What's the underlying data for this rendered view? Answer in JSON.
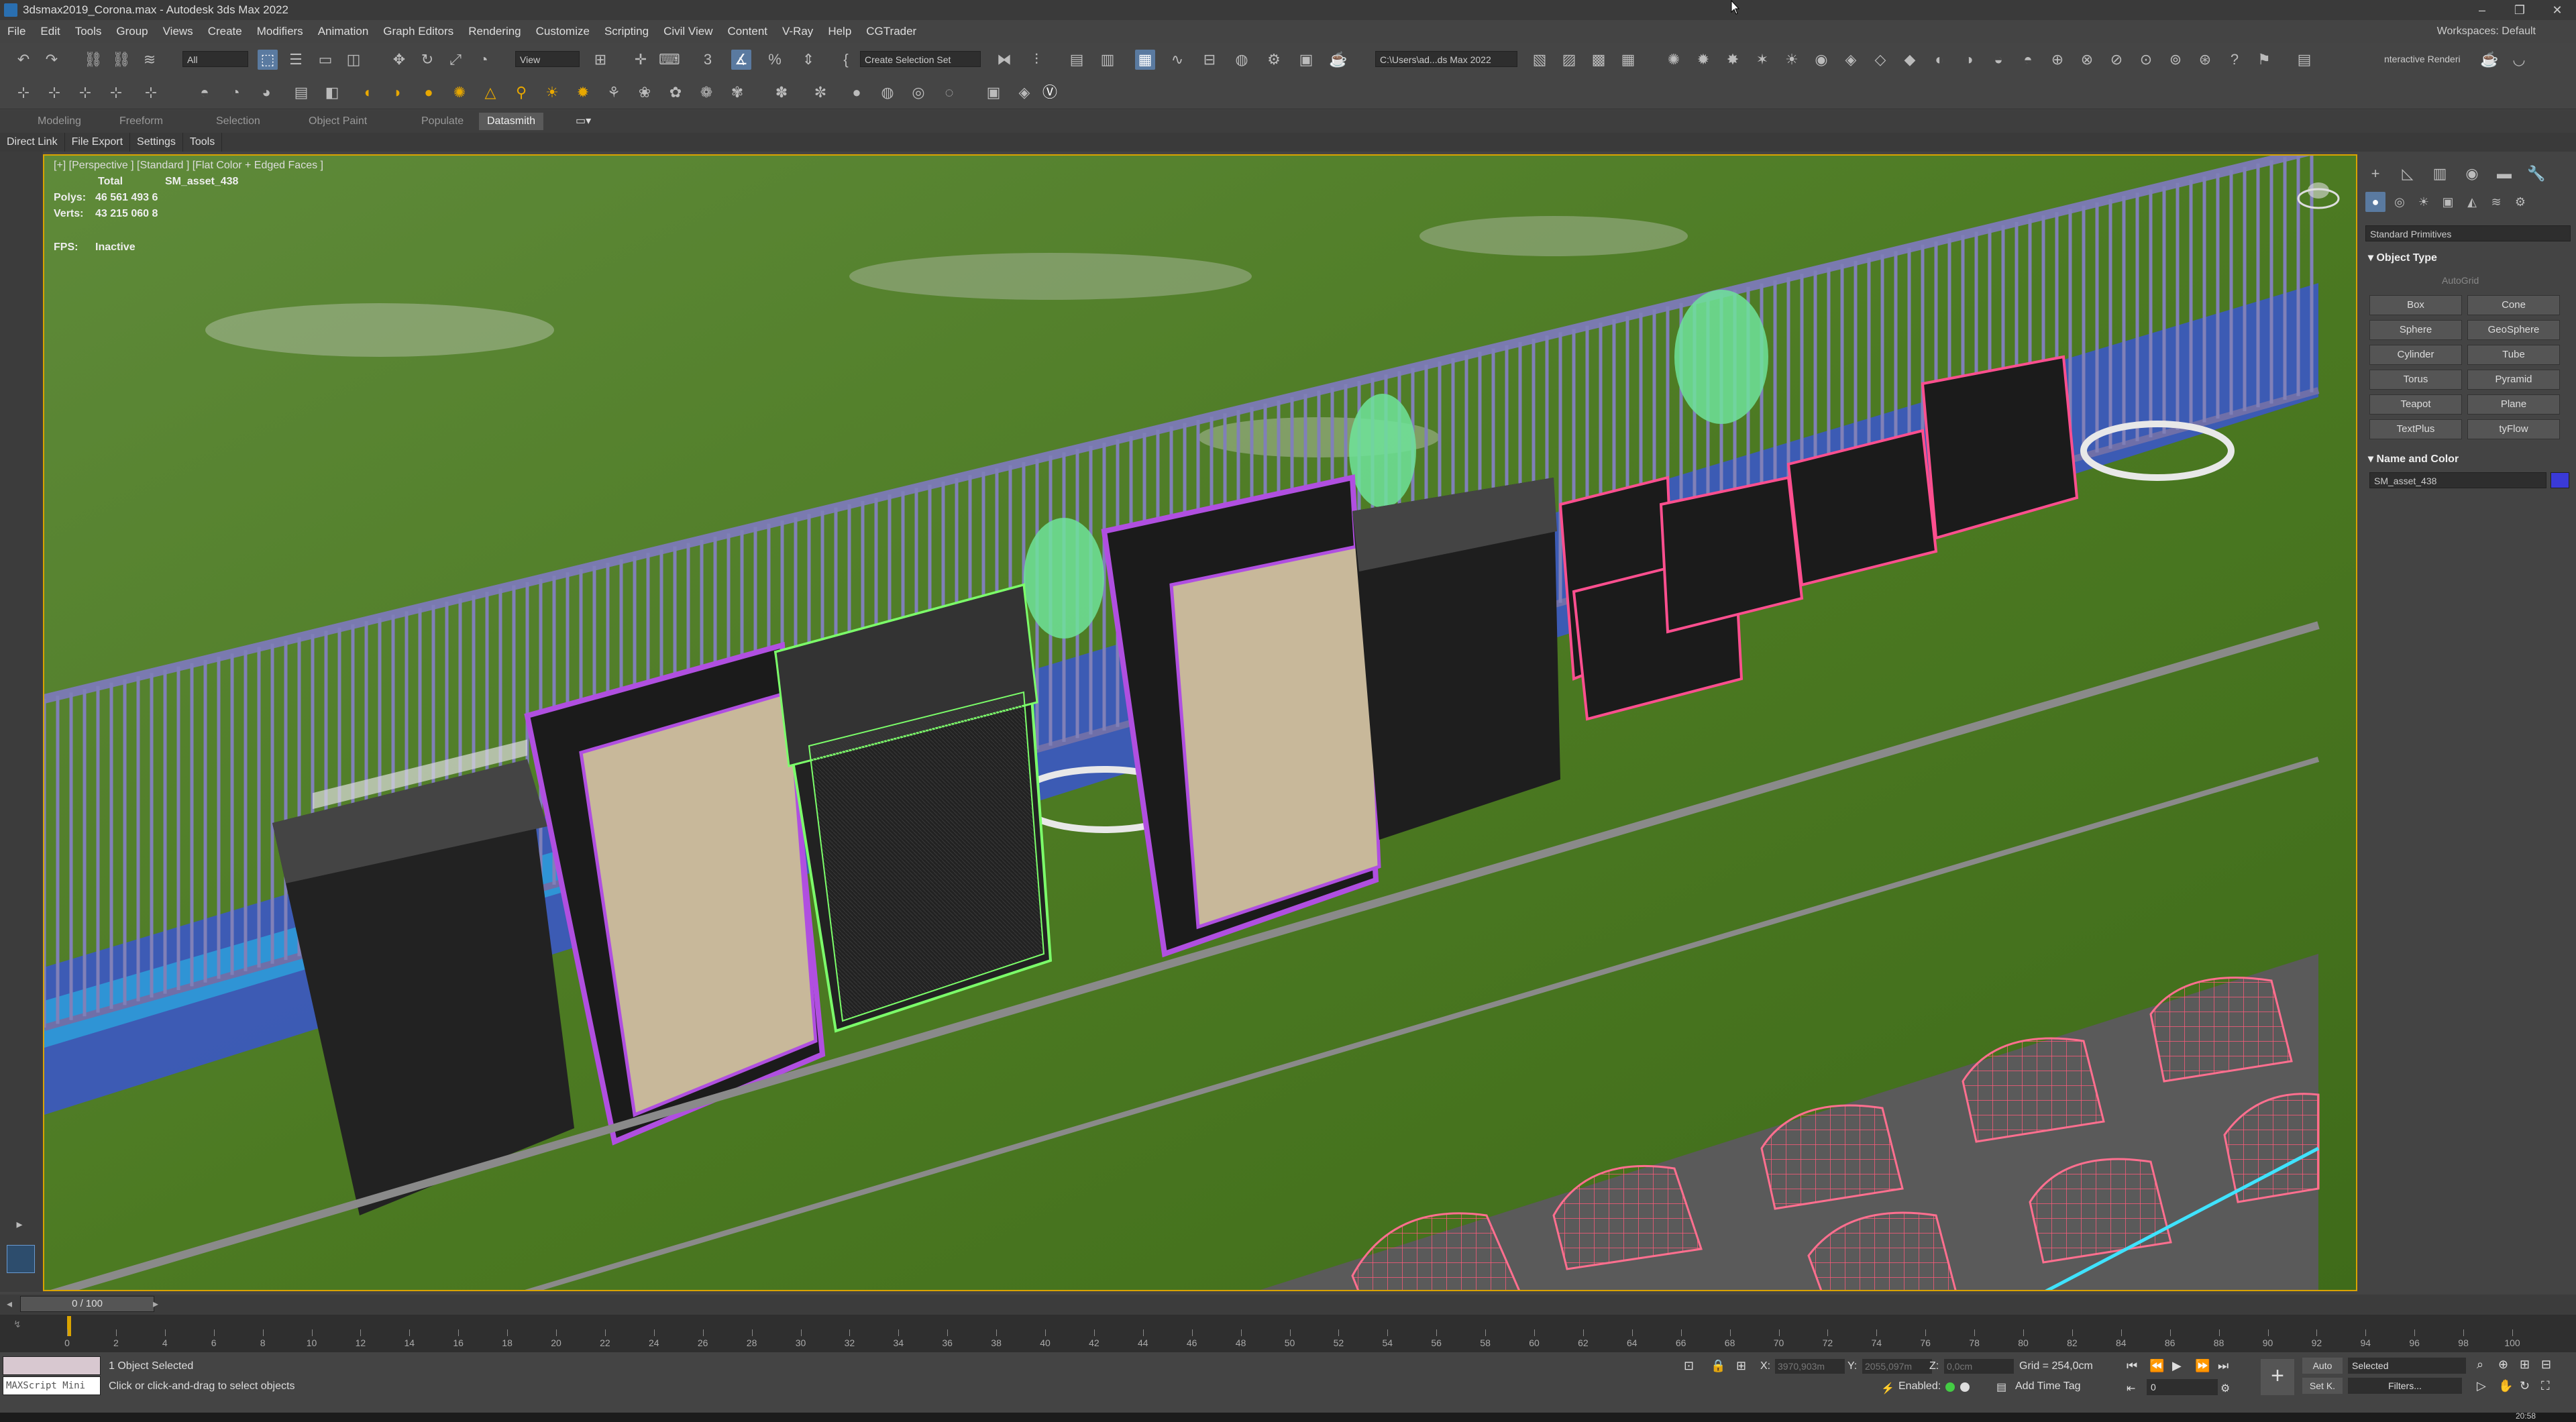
{
  "window": {
    "title": "3dsmax2019_Corona.max - Autodesk 3ds Max 2022",
    "minimize": "–",
    "maximize": "❐",
    "close": "✕"
  },
  "menu": {
    "items": [
      "File",
      "Edit",
      "Tools",
      "Group",
      "Views",
      "Create",
      "Modifiers",
      "Animation",
      "Graph Editors",
      "Rendering",
      "Customize",
      "Scripting",
      "Civil View",
      "Content",
      "V-Ray",
      "Help",
      "CGTrader"
    ],
    "workspaces_label": "Workspaces:",
    "workspaces_value": "Default"
  },
  "toolbar": {
    "selection_filter": "All",
    "view_dropdown": "View",
    "create_selection_set": "Create Selection Set",
    "project_path": "C:\\Users\\ad...ds Max 2022",
    "interactive_render": "nteractive Renderi"
  },
  "ribbon": {
    "tabs": [
      "Modeling",
      "Freeform",
      "Selection",
      "Object Paint",
      "Populate",
      "Datasmith"
    ],
    "active_tab": "Datasmith",
    "subtabs": [
      "Direct Link",
      "File Export",
      "Settings",
      "Tools"
    ]
  },
  "viewport": {
    "label": "[+] [Perspective ] [Standard ] [Flat Color + Edged Faces ]",
    "stats_total_label": "Total",
    "stats_object": "SM_asset_438",
    "polys_label": "Polys:",
    "polys_value": "46 561 493   6",
    "verts_label": "Verts:",
    "verts_value": "43 215 060   8",
    "fps_label": "FPS:",
    "fps_value": "Inactive"
  },
  "command_panel": {
    "category": "Standard Primitives",
    "object_type_header": "Object Type",
    "autogrid": "AutoGrid",
    "buttons": [
      "Box",
      "Cone",
      "Sphere",
      "GeoSphere",
      "Cylinder",
      "Tube",
      "Torus",
      "Pyramid",
      "Teapot",
      "Plane",
      "TextPlus",
      "tyFlow"
    ],
    "name_color_header": "Name and Color",
    "object_name": "SM_asset_438",
    "object_color": "#3a3ad8"
  },
  "timeline": {
    "frame_display": "0 / 100",
    "ticks": [
      "0",
      "2",
      "4",
      "6",
      "8",
      "10",
      "12",
      "14",
      "16",
      "18",
      "20",
      "22",
      "24",
      "26",
      "28",
      "30",
      "32",
      "34",
      "36",
      "38",
      "40",
      "42",
      "44",
      "46",
      "48",
      "50",
      "52",
      "54",
      "56",
      "58",
      "60",
      "62",
      "64",
      "66",
      "68",
      "70",
      "72",
      "74",
      "76",
      "78",
      "80",
      "82",
      "84",
      "86",
      "88",
      "90",
      "92",
      "94",
      "96",
      "98",
      "100"
    ]
  },
  "status": {
    "maxscript_label": "MAXScript Mini",
    "selection_info": "1 Object Selected",
    "prompt": "Click or click-and-drag to select objects",
    "x_label": "X:",
    "x_value": "3970,903m",
    "y_label": "Y:",
    "y_value": "2055,097m",
    "z_label": "Z:",
    "z_value": "0,0cm",
    "grid": "Grid = 254,0cm",
    "enabled_label": "Enabled:",
    "add_time_tag": "Add Time Tag",
    "auto": "Auto",
    "set_key": "Set K.",
    "selected_dropdown": "Selected",
    "filters": "Filters...",
    "frame_field": "0",
    "clock": "20:58"
  }
}
